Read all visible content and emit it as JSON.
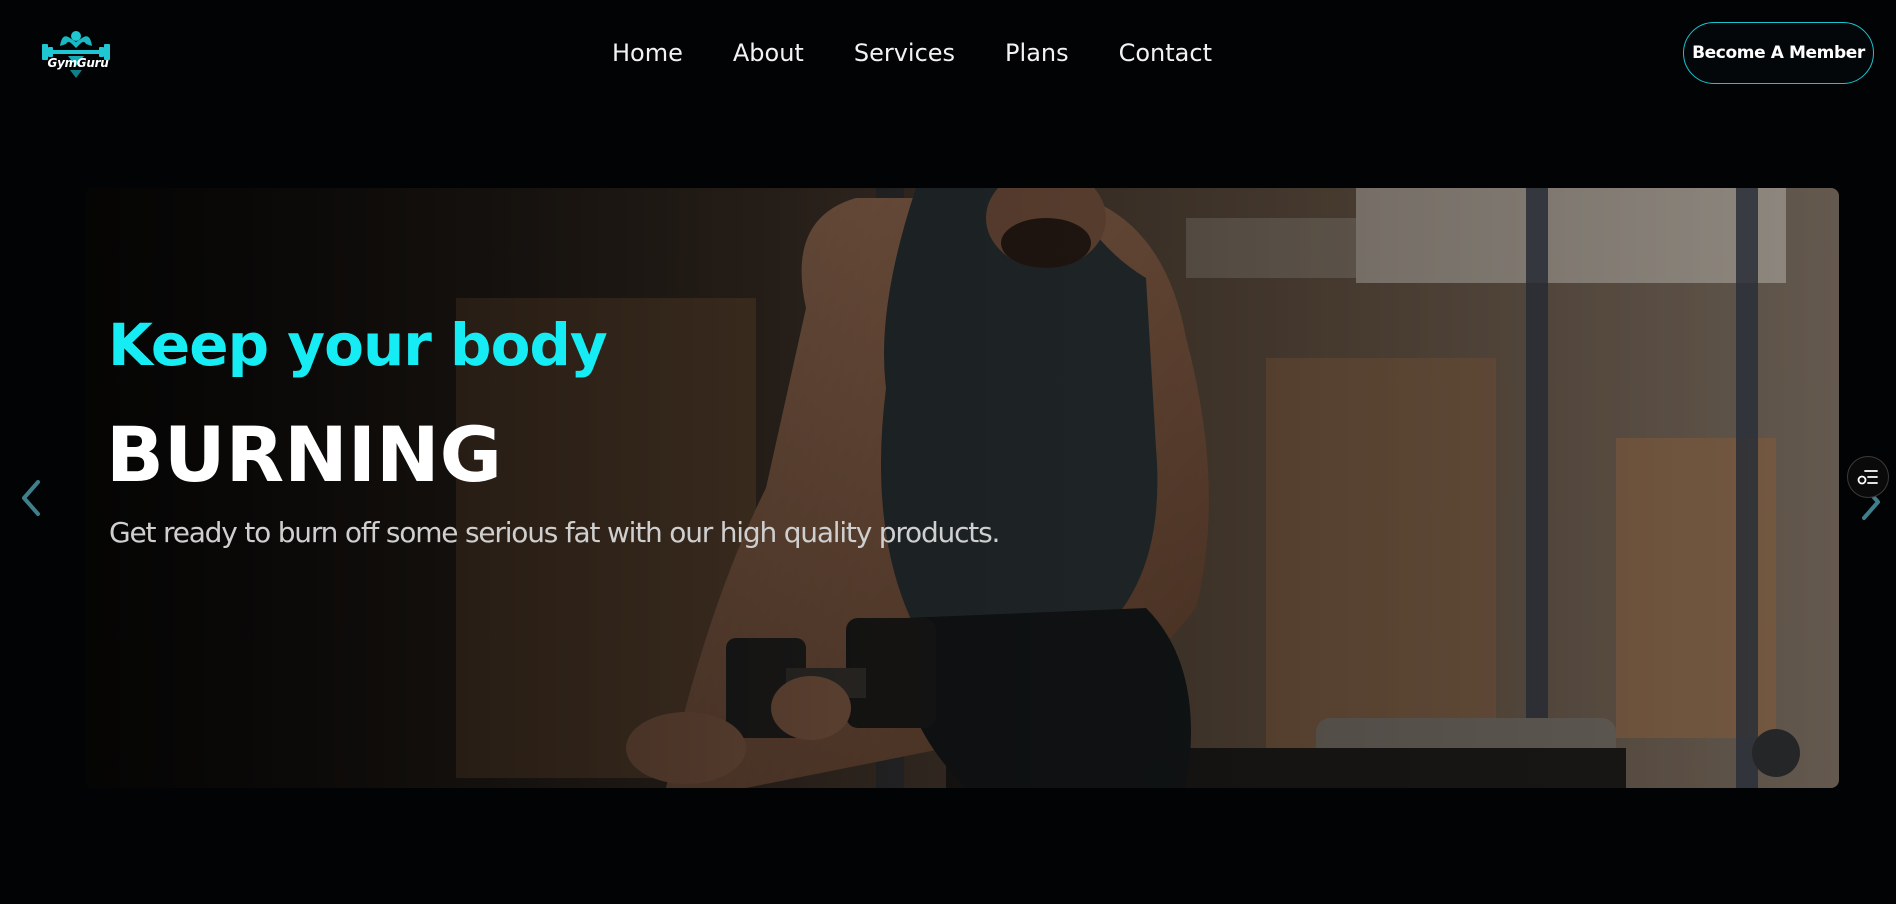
{
  "brand": {
    "name": "GymGuru",
    "accent_color": "#16ecf3",
    "logo_icon": "muscle-dumbbell-logo"
  },
  "nav": {
    "items": [
      {
        "label": "Home"
      },
      {
        "label": "About"
      },
      {
        "label": "Services"
      },
      {
        "label": "Plans"
      },
      {
        "label": "Contact"
      }
    ]
  },
  "header": {
    "cta_label": "Become A Member"
  },
  "hero": {
    "tagline": "Keep your body",
    "headline": "BURNING",
    "subtitle": "Get ready to burn off some serious fat with our high quality products.",
    "image": "man-lifting-dumbbell-photo",
    "prev_icon": "chevron-left-icon",
    "next_icon": "chevron-right-icon"
  },
  "floating": {
    "icon": "settings-list-icon"
  }
}
